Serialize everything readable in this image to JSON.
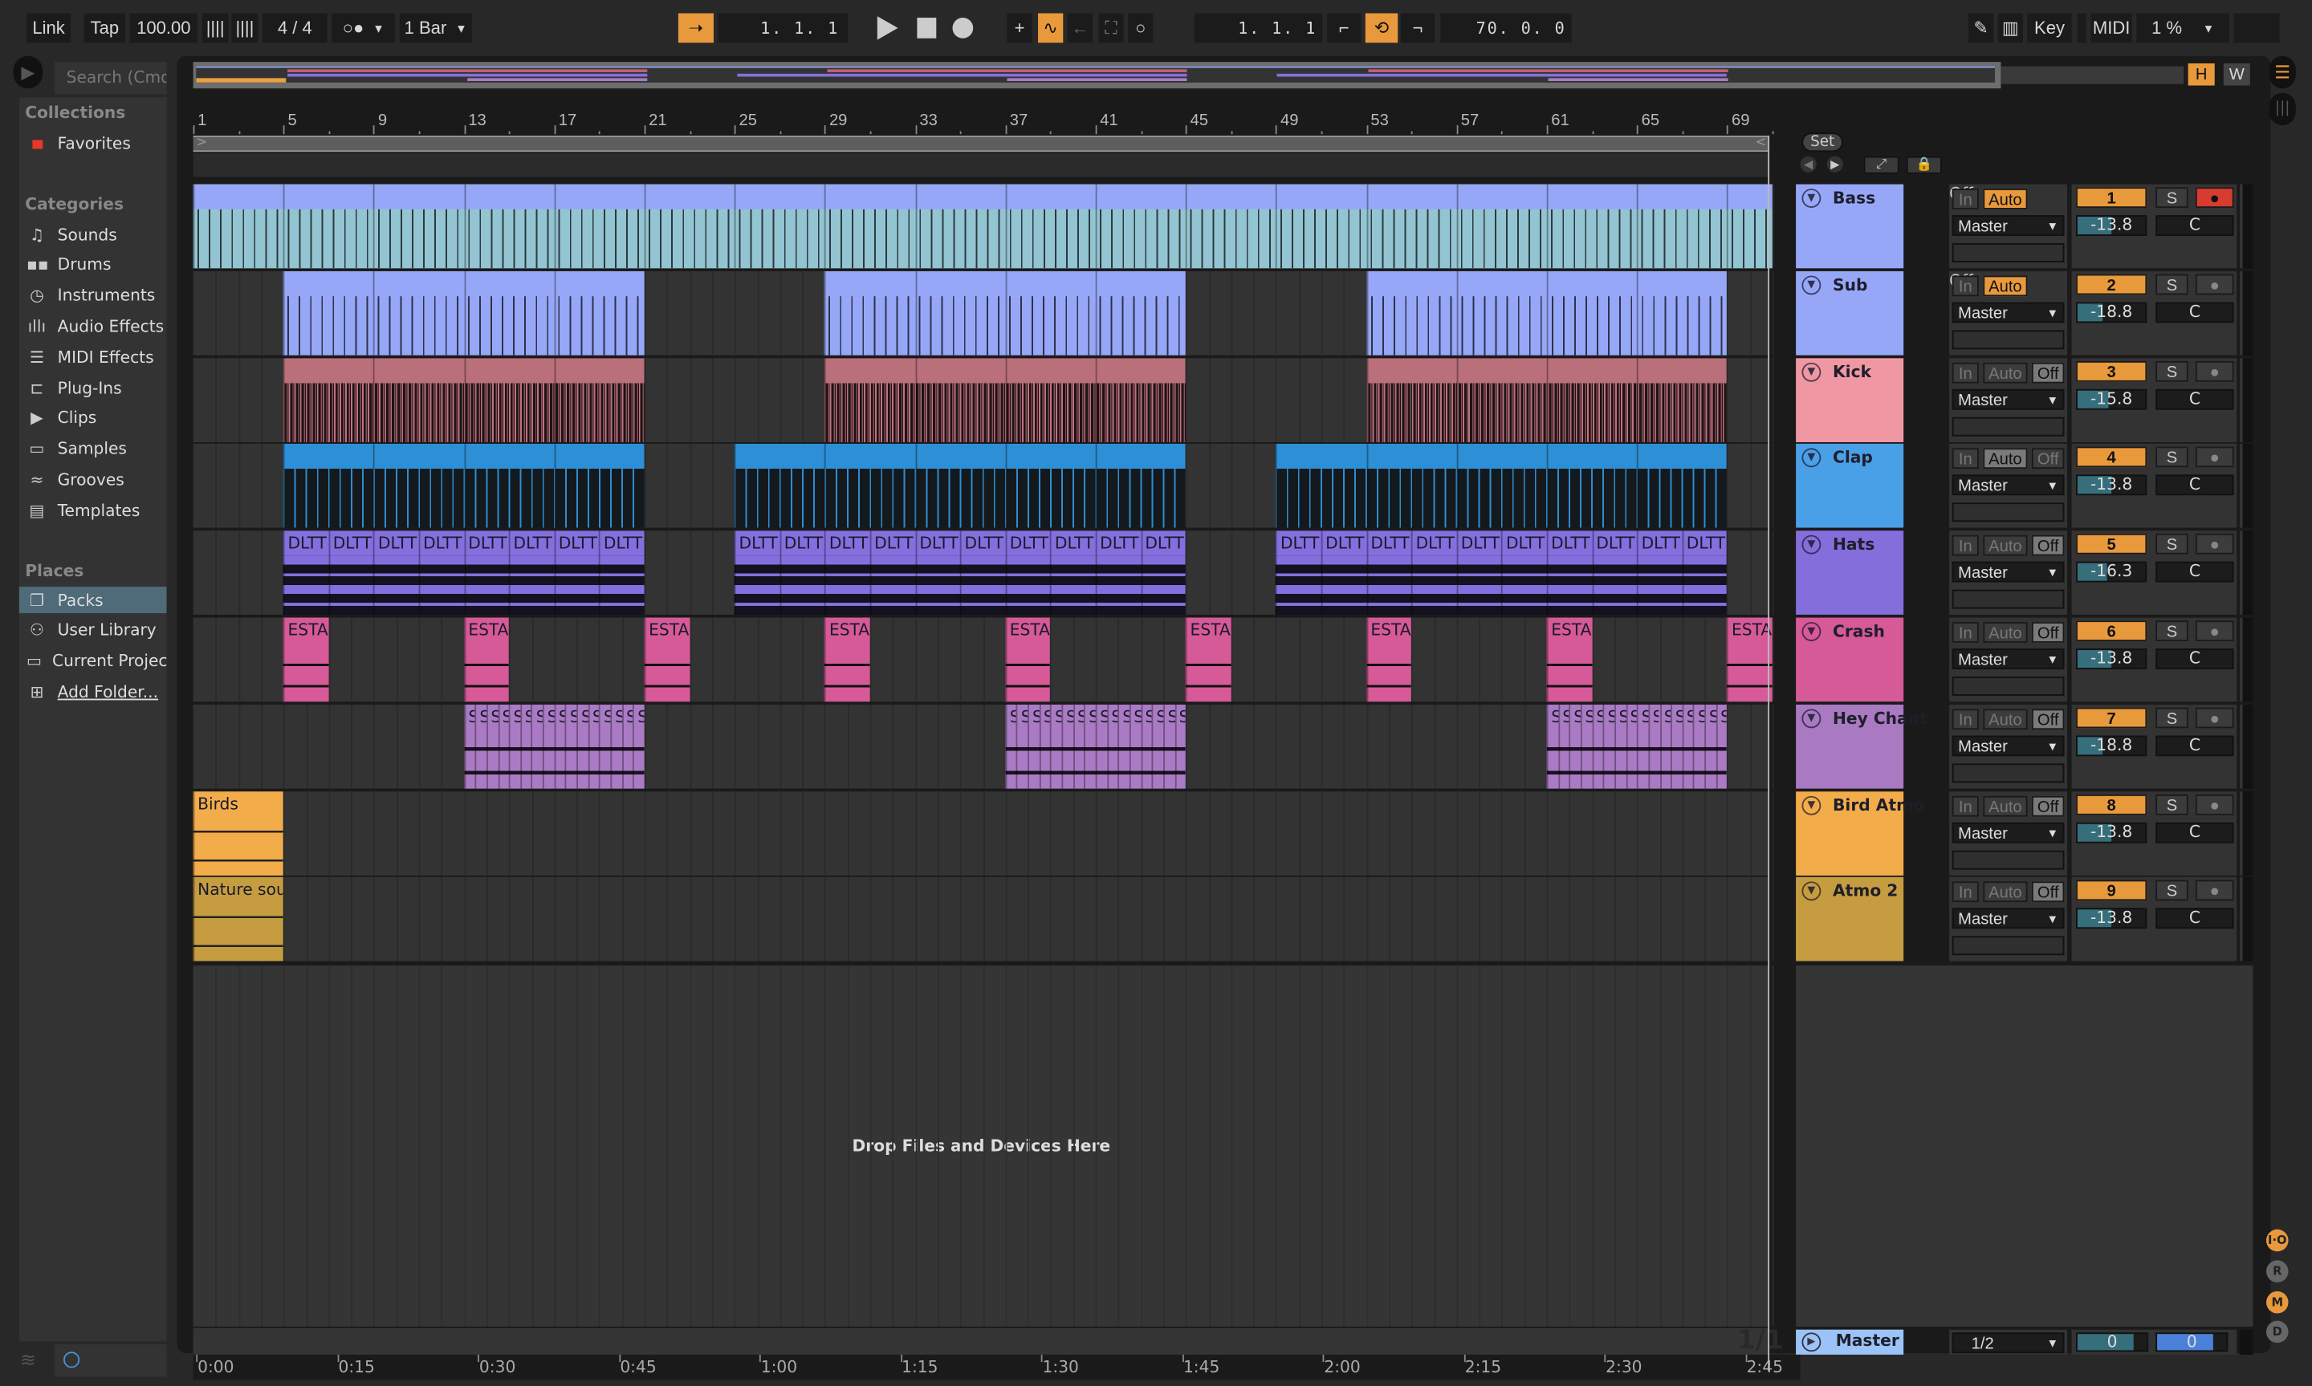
{
  "toolbar": {
    "link": "Link",
    "tap": "Tap",
    "tempo": "100.00",
    "time_signature": "4 / 4",
    "metronome": "○●",
    "quantize": "1 Bar",
    "position": "1.  1.  1",
    "loop_start": "1.  1.  1",
    "loop_length": "70.  0.  0",
    "key": "Key",
    "midi": "MIDI",
    "cpu": "1 %"
  },
  "overview": {
    "h_label": "H",
    "w_label": "W"
  },
  "browser": {
    "search_placeholder": "Search (Cmd",
    "collections_header": "Collections",
    "favorites": "Favorites",
    "categories_header": "Categories",
    "categories": [
      {
        "label": "Sounds",
        "icon": "♫"
      },
      {
        "label": "Drums",
        "icon": "▪▪"
      },
      {
        "label": "Instruments",
        "icon": "◷"
      },
      {
        "label": "Audio Effects",
        "icon": "ıllı"
      },
      {
        "label": "MIDI Effects",
        "icon": "☰"
      },
      {
        "label": "Plug-Ins",
        "icon": "⊏"
      },
      {
        "label": "Clips",
        "icon": "▶"
      },
      {
        "label": "Samples",
        "icon": "▭"
      },
      {
        "label": "Grooves",
        "icon": "≈"
      },
      {
        "label": "Templates",
        "icon": "▤"
      }
    ],
    "places_header": "Places",
    "places": [
      {
        "label": "Packs",
        "icon": "❐",
        "selected": true
      },
      {
        "label": "User Library",
        "icon": "⚇"
      },
      {
        "label": "Current Project",
        "icon": "▭"
      },
      {
        "label": "Add Folder...",
        "icon": "⊞"
      }
    ]
  },
  "ruler": {
    "bars": [
      "1",
      "5",
      "9",
      "13",
      "17",
      "21",
      "25",
      "29",
      "33",
      "37",
      "41",
      "45",
      "49",
      "53",
      "57",
      "61",
      "65",
      "69"
    ]
  },
  "time_ruler": [
    "0:00",
    "0:15",
    "0:30",
    "0:45",
    "1:00",
    "1:15",
    "1:30",
    "1:45",
    "2:00",
    "2:15",
    "2:30",
    "2:45"
  ],
  "set_button": "Set",
  "drop_text": "Drop Files and Devices Here",
  "scene_counter": "1/1",
  "monitor_labels": {
    "in": "In",
    "auto": "Auto",
    "off": "Off"
  },
  "solo_label": "S",
  "tracks": [
    {
      "name": "Bass",
      "color": "#97a7f8",
      "number": "1",
      "monitor": "auto",
      "output": "Master",
      "volume": "-13.8",
      "volume_fraction": 0.5,
      "pan": "C",
      "arm": true,
      "kind": "midi",
      "clip_head": "#97a7f8",
      "clip_body": "#93c4d2",
      "clips": [
        {
          "start": 1,
          "end": 71,
          "label": "",
          "segment": 4
        }
      ]
    },
    {
      "name": "Sub",
      "color": "#97a7f8",
      "number": "2",
      "monitor": "auto",
      "output": "Master",
      "volume": "-18.8",
      "volume_fraction": 0.38,
      "pan": "C",
      "arm": false,
      "kind": "midi",
      "clip_head": "#97a7f8",
      "clip_body": "#97a7f8",
      "clips": [
        {
          "start": 5,
          "end": 21,
          "label": "",
          "segment": 4
        },
        {
          "start": 29,
          "end": 45,
          "label": "",
          "segment": 4
        },
        {
          "start": 53,
          "end": 69,
          "label": "",
          "segment": 4
        }
      ]
    },
    {
      "name": "Kick",
      "color": "#ef98a3",
      "number": "3",
      "monitor": "off",
      "output": "Master",
      "volume": "-15.8",
      "volume_fraction": 0.45,
      "pan": "C",
      "arm": false,
      "kind": "kick",
      "clip_head": "#b9707b",
      "clip_body": "#1c1315",
      "clips": [
        {
          "start": 5,
          "end": 21,
          "label": "",
          "segment": 4
        },
        {
          "start": 29,
          "end": 45,
          "label": "",
          "segment": 4
        },
        {
          "start": 53,
          "end": 69,
          "label": "",
          "segment": 4
        }
      ]
    },
    {
      "name": "Clap",
      "color": "#4aa0e6",
      "number": "4",
      "monitor": "auto-lit",
      "output": "Master",
      "volume": "-13.8",
      "volume_fraction": 0.5,
      "pan": "C",
      "arm": false,
      "kind": "clap",
      "clip_head": "#2d8fd5",
      "clip_body": "#14191d",
      "clips": [
        {
          "start": 5,
          "end": 21,
          "label": "",
          "segment": 4
        },
        {
          "start": 25,
          "end": 45,
          "label": "",
          "segment": 4
        },
        {
          "start": 49,
          "end": 69,
          "label": "",
          "segment": 4
        }
      ]
    },
    {
      "name": "Hats",
      "color": "#836edc",
      "number": "5",
      "monitor": "off",
      "output": "Master",
      "volume": "-16.3",
      "volume_fraction": 0.44,
      "pan": "C",
      "arm": false,
      "kind": "audio",
      "clip_head": "#846fde",
      "clip_body": "#15121f",
      "clips": [
        {
          "start": 5,
          "end": 21,
          "label": "DLTT",
          "segment": 2
        },
        {
          "start": 25,
          "end": 45,
          "label": "DLTT",
          "segment": 2
        },
        {
          "start": 49,
          "end": 69,
          "label": "DLTT",
          "segment": 2
        }
      ]
    },
    {
      "name": "Crash",
      "color": "#d65a98",
      "number": "6",
      "monitor": "off",
      "output": "Master",
      "volume": "-13.8",
      "volume_fraction": 0.5,
      "pan": "C",
      "arm": false,
      "kind": "crash",
      "clip_head": "#d65a98",
      "clip_body": "#d65a98",
      "clips": [
        {
          "start": 5,
          "end": 7,
          "label": "ESTA",
          "segment": 2
        },
        {
          "start": 13,
          "end": 15,
          "label": "ESTA",
          "segment": 2
        },
        {
          "start": 21,
          "end": 23,
          "label": "ESTA",
          "segment": 2
        },
        {
          "start": 29,
          "end": 31,
          "label": "ESTA",
          "segment": 2
        },
        {
          "start": 37,
          "end": 39,
          "label": "ESTA",
          "segment": 2
        },
        {
          "start": 45,
          "end": 47,
          "label": "ESTA",
          "segment": 2
        },
        {
          "start": 53,
          "end": 55,
          "label": "ESTA",
          "segment": 2
        },
        {
          "start": 61,
          "end": 63,
          "label": "ESTA",
          "segment": 2
        },
        {
          "start": 69,
          "end": 71,
          "label": "ESTA",
          "segment": 2
        }
      ]
    },
    {
      "name": "Hey Chant",
      "color": "#a979c2",
      "number": "7",
      "monitor": "off",
      "output": "Master",
      "volume": "-18.8",
      "volume_fraction": 0.38,
      "pan": "C",
      "arm": false,
      "kind": "chant",
      "clip_head": "#aa7bc4",
      "clip_body": "#aa7bc4",
      "clips": [
        {
          "start": 13,
          "end": 21,
          "label": "S",
          "segment": 0.5
        },
        {
          "start": 37,
          "end": 45,
          "label": "S",
          "segment": 0.5
        },
        {
          "start": 61,
          "end": 69,
          "label": "S",
          "segment": 0.5
        }
      ]
    },
    {
      "name": "Bird Atmo",
      "color": "#f2ac4a",
      "number": "8",
      "monitor": "off",
      "output": "Master",
      "volume": "-13.8",
      "volume_fraction": 0.5,
      "pan": "C",
      "arm": false,
      "kind": "atmo",
      "clip_head": "#f2ac4a",
      "clip_body": "#f2ac4a",
      "clips": [
        {
          "start": 1,
          "end": 5,
          "label": "Birds",
          "segment": 4
        }
      ]
    },
    {
      "name": "Atmo 2",
      "color": "#c59d40",
      "number": "9",
      "monitor": "off",
      "output": "Master",
      "volume": "-13.8",
      "volume_fraction": 0.5,
      "pan": "C",
      "arm": false,
      "kind": "atmo",
      "clip_head": "#c59d40",
      "clip_body": "#c59d40",
      "clips": [
        {
          "start": 1,
          "end": 5,
          "label": "Nature sou",
          "segment": 4
        }
      ]
    }
  ],
  "master": {
    "name": "Master",
    "color": "#9bc3f8",
    "output": "1/2",
    "volume": "0",
    "pan": "0"
  },
  "side_buttons": [
    {
      "label": "I·O",
      "active": true
    },
    {
      "label": "R",
      "active": false
    },
    {
      "label": "M",
      "active": true
    },
    {
      "label": "D",
      "active": false
    }
  ],
  "colors": {
    "accent": "#e8993c",
    "volume_fill": "#376e7c",
    "selected_place": "#4f6a78",
    "arm_red": "#d63c30"
  }
}
